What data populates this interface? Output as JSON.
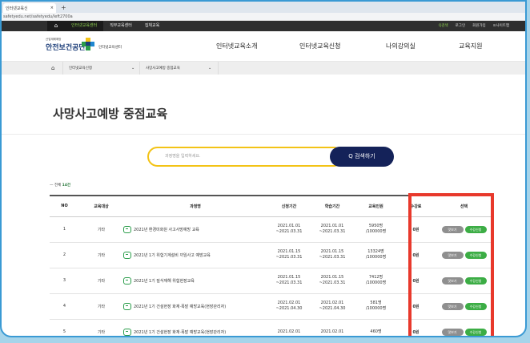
{
  "browser": {
    "tab_title": "인터넷교육신",
    "tab_close": "×",
    "new_tab": "+",
    "url": "safetyedu.net/safetyedu/left2700a"
  },
  "topnav": {
    "items": [
      "인터넷교육센터",
      "직무교육센터",
      "집체교육"
    ],
    "utils": [
      "Q검색",
      "로그인",
      "회원가입",
      "≡사이트맵"
    ]
  },
  "header": {
    "logo_small": "산업재해예방",
    "logo_name": "안전보건공단",
    "logo_sub": "인터넷교육센터",
    "menu": [
      "인터넷교육소개",
      "인터넷교육신청",
      "나의강의실",
      "교육지원"
    ]
  },
  "breadcrumb": {
    "level1": "인터넷교육신청",
    "level2": "사망사고예방 중점교육"
  },
  "page_title": "사망사고예방 중점교육",
  "search": {
    "placeholder": "과정명을 입력하세요.",
    "button": "Q 검색하기"
  },
  "total": {
    "prefix": "전체",
    "count": "14건"
  },
  "table": {
    "headers": [
      "NO",
      "교육대상",
      "과정명",
      "신청기간",
      "학습기간",
      "교육인원",
      "수강료",
      "선택"
    ],
    "rows": [
      {
        "no": "1",
        "target": "기타",
        "course": "2021년 환경미화원 사고사망예방 교육",
        "apply1": "2021.01.01",
        "apply2": "~2021.03.31",
        "study1": "2021.01.01",
        "study2": "~2021.03.31",
        "people1": "5950명",
        "people2": "/100000명",
        "fee": "0원"
      },
      {
        "no": "2",
        "target": "기타",
        "course": "2021년 1기 위험기계설비 끼임사고 예방교육",
        "apply1": "2021.01.15",
        "apply2": "~2021.03.31",
        "study1": "2021.01.15",
        "study2": "~2021.03.31",
        "people1": "13324명",
        "people2": "/100000명",
        "fee": "0원"
      },
      {
        "no": "3",
        "target": "기타",
        "course": "2021년 1기 질식재해 위험현장교육",
        "apply1": "2021.01.15",
        "apply2": "~2021.03.31",
        "study1": "2021.01.15",
        "study2": "~2021.03.31",
        "people1": "7412명",
        "people2": "/100000명",
        "fee": "0원"
      },
      {
        "no": "4",
        "target": "기타",
        "course": "2021년 1기 건설현장 화재·폭발 예방교육(현장관리자)",
        "apply1": "2021.02.01",
        "apply2": "~2021.04.30",
        "study1": "2021.02.01",
        "study2": "~2021.04.30",
        "people1": "581명",
        "people2": "/100000명",
        "fee": "0원"
      },
      {
        "no": "5",
        "target": "기타",
        "course": "2021년 1기 건설현장 화재·폭발 예방교육(현장관리자)",
        "apply1": "2021.02.01",
        "apply2": "",
        "study1": "2021.02.01",
        "study2": "",
        "people1": "460명",
        "people2": "",
        "fee": "0원"
      }
    ],
    "btn_view": "맛보기",
    "btn_apply": "수강신청"
  }
}
